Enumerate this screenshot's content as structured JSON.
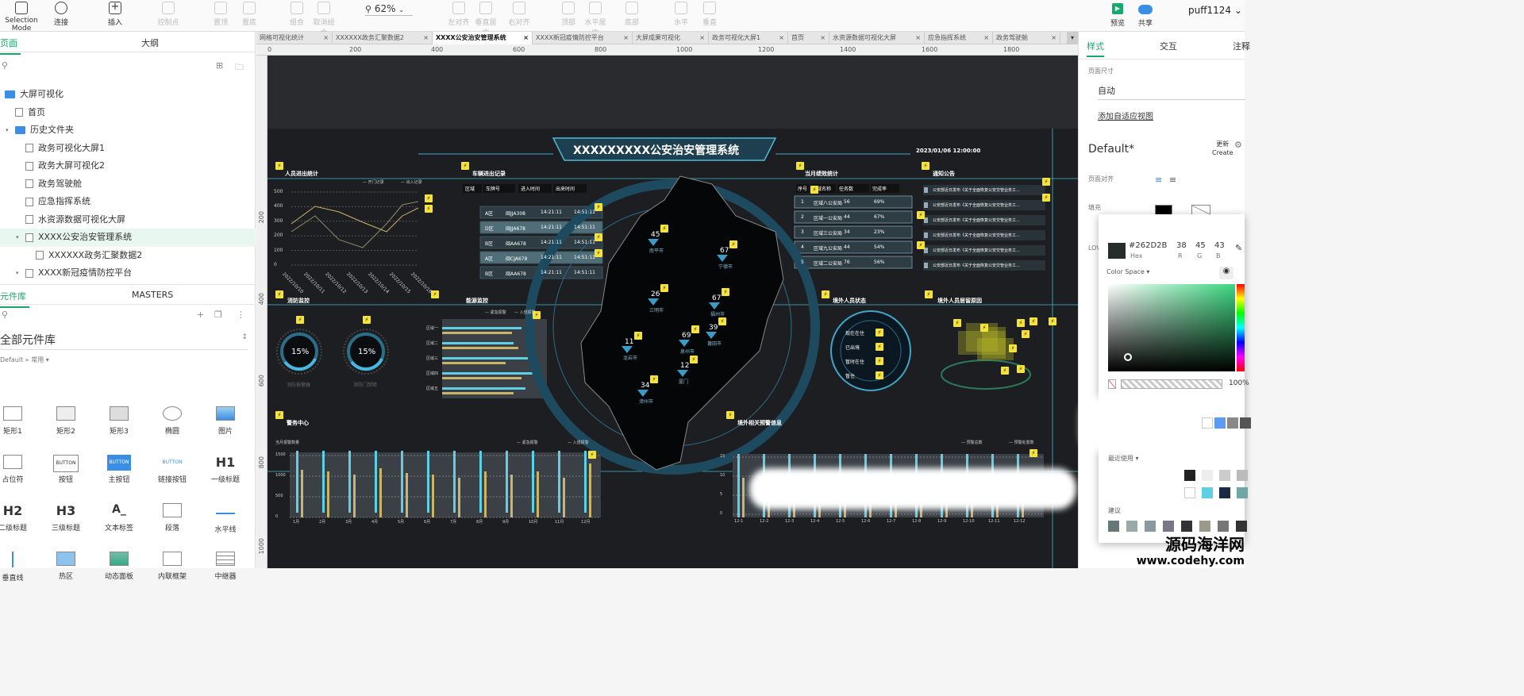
{
  "toolbar": {
    "selection_mode": "Selection Mode",
    "connect": "连接",
    "insert": "插入",
    "dim_items": [
      "控制点",
      "置顶",
      "置底",
      "组合",
      "取消组合",
      "左对齐",
      "垂直居中",
      "右对齐",
      "顶部",
      "水平居中",
      "底部",
      "水平",
      "垂直"
    ],
    "zoom": "62%",
    "preview": "预览",
    "share": "共享",
    "user": "puff1124"
  },
  "left_panel": {
    "tabs": [
      "页面",
      "大纲"
    ],
    "pages": [
      {
        "label": "大屏可视化",
        "type": "folder",
        "level": 0
      },
      {
        "label": "首页",
        "type": "page",
        "level": 1
      },
      {
        "label": "历史文件夹",
        "type": "folder",
        "level": 1
      },
      {
        "label": "政务可视化大屏1",
        "type": "page",
        "level": 2
      },
      {
        "label": "政务大屏可视化2",
        "type": "page",
        "level": 2
      },
      {
        "label": "政务驾驶舱",
        "type": "page",
        "level": 2
      },
      {
        "label": "应急指挥系统",
        "type": "page",
        "level": 2
      },
      {
        "label": "水资源数据可视化大屏",
        "type": "page",
        "level": 2
      },
      {
        "label": "XXXX公安治安管理系统",
        "type": "page",
        "level": 2,
        "selected": true
      },
      {
        "label": "XXXXXX政务汇聚数据2",
        "type": "page",
        "level": 3
      },
      {
        "label": "XXXX新冠疫情防控平台",
        "type": "page",
        "level": 2
      }
    ],
    "lib_tabs": [
      "元件库",
      "MASTERS"
    ],
    "library_title": "全部元件库",
    "library_sub": "Default » 常用",
    "components": [
      "矩形1",
      "矩形2",
      "矩形3",
      "椭圆",
      "图片",
      "占位符",
      "按钮",
      "主按钮",
      "链接按钮",
      "一级标题",
      "二级标题",
      "三级标题",
      "文本标签",
      "段落",
      "水平线",
      "垂直线",
      "热区",
      "动态面板",
      "内联框架",
      "中继器"
    ],
    "comp_glyphs": {
      "button": "BUTTON",
      "h1": "H1",
      "h2": "H2",
      "h3": "H3",
      "label": "A_"
    }
  },
  "doc_tabs": [
    "网格可视化统计",
    "XXXXXX政务汇聚数据2",
    "XXXX公安治安管理系统",
    "XXXX新冠疫情防控平台",
    "大屏成果可视化",
    "政务可视化大屏1",
    "首页",
    "水资源数据可视化大屏",
    "应急指挥系统",
    "政务驾驶舱"
  ],
  "ruler": {
    "h": [
      "0",
      "200",
      "400",
      "600",
      "800",
      "1000",
      "1200",
      "1400",
      "1600",
      "1800"
    ],
    "v": [
      "200",
      "400",
      "600",
      "800",
      "1000"
    ]
  },
  "dashboard": {
    "title": "XXXXXXXXX公安治安管理系统",
    "datetime": "2023/01/06 12:00:00",
    "panels": {
      "people": "人员进出统计",
      "vehicle": "车辆进出记录",
      "perf": "当月绩效统计",
      "notice": "通知公告",
      "fire": "消防监控",
      "energy": "能源监控",
      "foreign": "境外人员状态",
      "foreign_stay": "境外人员居留原因",
      "police": "警务中心",
      "warning": "境外相关预警信息"
    },
    "people_legend": [
      "开门记录",
      "出入记录"
    ],
    "people_y": [
      "500",
      "400",
      "300",
      "200",
      "100",
      "0"
    ],
    "people_x": [
      "2022/10/10",
      "2022/10/11",
      "2022/10/12",
      "2022/10/13",
      "2022/10/14",
      "2022/10/15",
      "2022/10/16"
    ],
    "vehicle_headers": [
      "区域",
      "车牌号",
      "进入时间",
      "出来时间"
    ],
    "vehicle_rows": [
      [
        "A区",
        "闽JJA308",
        "14:21:11",
        "14:51:11"
      ],
      [
        "D区",
        "闽JJA678",
        "14:21:11",
        "14:51:11"
      ],
      [
        "B区",
        "闽AA678",
        "14:21:11",
        "14:51:11"
      ],
      [
        "A区",
        "闽CJA678",
        "14:21:11",
        "14:51:11"
      ],
      [
        "B区",
        "闽AA678",
        "14:21:11",
        "14:51:11"
      ]
    ],
    "perf_headers": [
      "序号",
      "区域名称",
      "任务数",
      "完成率"
    ],
    "perf_rows": [
      [
        "1",
        "区域八公安局",
        "56",
        "69%"
      ],
      [
        "2",
        "区域一公安局",
        "44",
        "67%"
      ],
      [
        "3",
        "区域三公安局",
        "34",
        "23%"
      ],
      [
        "4",
        "区域九公安局",
        "44",
        "54%"
      ],
      [
        "5",
        "区域二公安局",
        "76",
        "56%"
      ]
    ],
    "notices": [
      "公安部近日发布《关于全面恢复公安交管业务工...",
      "公安部近日发布《关于全面恢复公安交管业务工...",
      "公安部近日发布《关于全面恢复公安交管业务工...",
      "公安部近日发布《关于全面恢复公安交管业务工...",
      "公安部近日发布《关于全面恢复公安交管业务工...",
      "公安部近日发布《关于全面恢复公安交管业务工..."
    ],
    "gauges": [
      {
        "value": "15%",
        "label": "消防报警器"
      },
      {
        "value": "15%",
        "label": "消防门禁障"
      }
    ],
    "energy_legend": [
      "紧急报警",
      "入侵报警"
    ],
    "energy_cats": [
      "区域一",
      "区域二",
      "区域三",
      "区域四",
      "区域五"
    ],
    "foreign_status": [
      "现在在住",
      "已出境",
      "暂时在住",
      "暂住"
    ],
    "map_cities": [
      {
        "name": "南平市",
        "num": "45"
      },
      {
        "name": "宁德市",
        "num": "67"
      },
      {
        "name": "三明市",
        "num": "26"
      },
      {
        "name": "福州市",
        "num": "67"
      },
      {
        "name": "莆田市",
        "num": "39"
      },
      {
        "name": "泉州市",
        "num": "69"
      },
      {
        "name": "龙岩市",
        "num": "11"
      },
      {
        "name": "漳州市",
        "num": "34"
      },
      {
        "name": "厦门",
        "num": "12"
      }
    ],
    "police_subtitle": "当月报警数量",
    "police_legend": [
      "紧急报警",
      "入侵报警"
    ],
    "police_y": [
      "1500",
      "1000",
      "500",
      "0"
    ],
    "police_x": [
      "1月",
      "2月",
      "3月",
      "4月",
      "5月",
      "6月",
      "7月",
      "8月",
      "9月",
      "10月",
      "11月",
      "12月"
    ],
    "warning_legend": [
      "预警总数",
      "预警处置数"
    ],
    "warning_y": [
      "15",
      "10",
      "5",
      "0"
    ],
    "warning_x": [
      "12-1",
      "12-2",
      "12-3",
      "12-4",
      "12-5",
      "12-6",
      "12-7",
      "12-8",
      "12-9",
      "12-10",
      "12-11",
      "12-12"
    ]
  },
  "right_panel": {
    "tabs": [
      "样式",
      "交互",
      "注释"
    ],
    "page_size_label": "页面尺寸",
    "page_size_value": "自动",
    "adaptive_link": "添加自适应视图",
    "style_name": "Default*",
    "update": "更新",
    "create": "Create",
    "align_label": "页面对齐",
    "fill_label": "填充",
    "low_label": "LOV"
  },
  "color_picker": {
    "hex": "#262D2B",
    "r": "38",
    "g": "45",
    "b": "43",
    "hex_label": "Hex",
    "r_label": "R",
    "g_label": "G",
    "b_label": "B",
    "color_space": "Color Space",
    "opacity": "100%",
    "recent_label": "最近使用",
    "suggest_label": "建议"
  },
  "watermark": {
    "line1": "源码海洋网",
    "line2": "www.codehy.com"
  },
  "colors": {
    "accent": "#17a96b",
    "bolt": "#f5e23a",
    "dash_bg": "#1d1e21",
    "cyan": "#5fd0e3",
    "gold": "#c9b46a",
    "picked": "#262d2b"
  }
}
